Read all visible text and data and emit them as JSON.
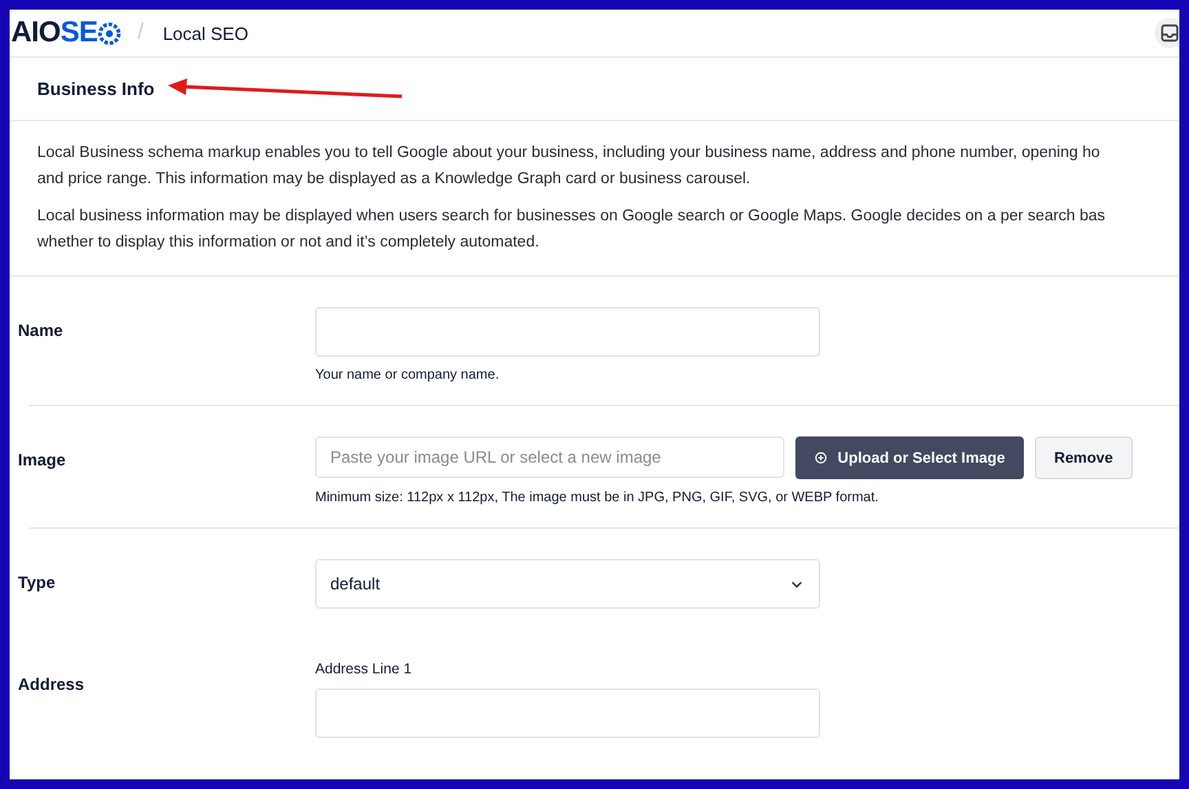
{
  "header": {
    "logo_dark": "AIO",
    "logo_accent": "SE",
    "breadcrumb_separator": "/",
    "breadcrumb": "Local SEO"
  },
  "section_title": "Business Info",
  "annotation": {
    "kind": "arrow"
  },
  "description": [
    [
      "Local Business schema markup enables you to tell Google about your business, including your business name, address and phone number, opening ho",
      "and price range. This information may be displayed as a Knowledge Graph card or business carousel."
    ],
    [
      "Local business information may be displayed when users search for businesses on Google search or Google Maps. Google decides on a per search bas",
      "whether to display this information or not and it’s completely automated."
    ]
  ],
  "fields": [
    {
      "kind": "text",
      "label": "Name",
      "help": "Your name or company name."
    },
    {
      "kind": "image",
      "label": "Image",
      "placeholder": "Paste your image URL or select a new image",
      "upload_button": "Upload or Select Image",
      "remove_button": "Remove",
      "help": "Minimum size: 112px x 112px, The image must be in JPG, PNG, GIF, SVG, or WEBP format."
    },
    {
      "kind": "select",
      "label": "Type",
      "value": "default"
    },
    {
      "kind": "address",
      "label": "Address",
      "sublabel": "Address Line 1"
    }
  ]
}
